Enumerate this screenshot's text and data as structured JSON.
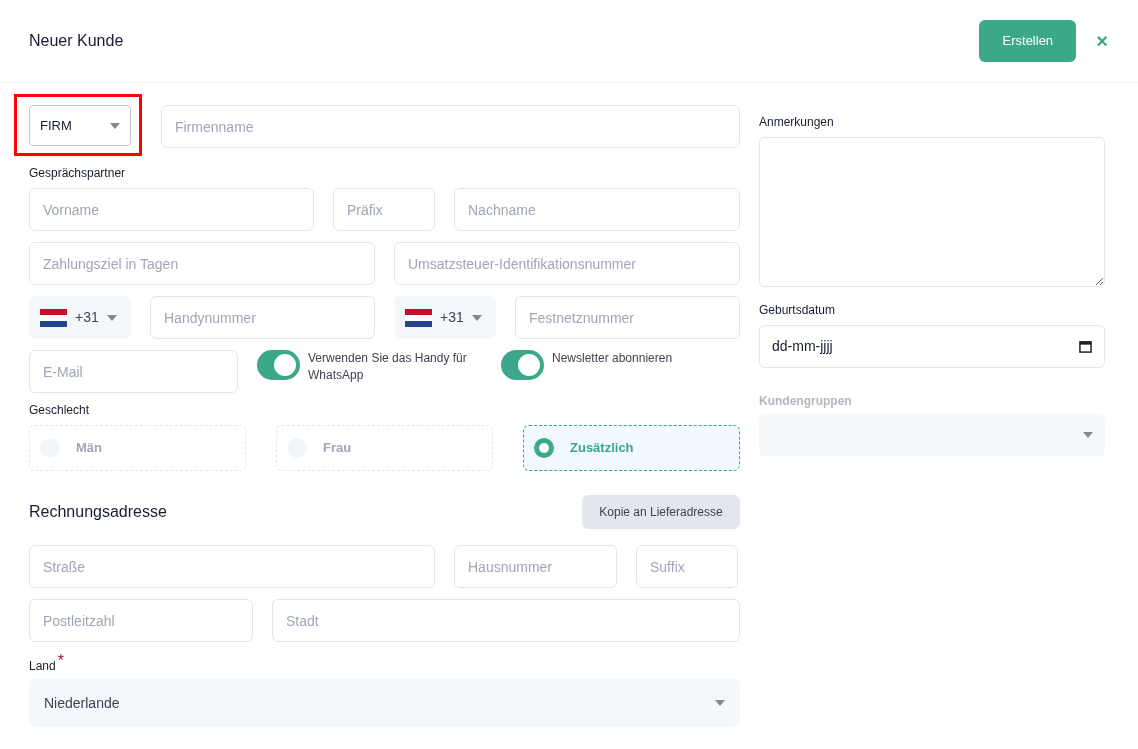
{
  "header": {
    "title": "Neuer Kunde",
    "create_button": "Erstellen",
    "close_button": "×"
  },
  "customer_type": {
    "value": "FIRM",
    "highlighted": true
  },
  "company_name": {
    "placeholder": "Firmenname"
  },
  "contact_label": "Gesprächspartner",
  "contact": [
    {
      "placeholder": "Vorname"
    },
    {
      "placeholder": "Präfix"
    },
    {
      "placeholder": "Nachname"
    }
  ],
  "payment_term": {
    "placeholder": "Zahlungsziel in Tagen"
  },
  "vat_id": {
    "placeholder": "Umsatzsteuer-Identifikationsnummer"
  },
  "phones": [
    {
      "code": "+31",
      "placeholder": "Handynummer"
    },
    {
      "code": "+31",
      "placeholder": "Festnetznummer"
    }
  ],
  "email": {
    "placeholder": "E-Mail"
  },
  "toggles": [
    {
      "label": "Verwenden Sie das Handy für WhatsApp",
      "on": true
    },
    {
      "label": "Newsletter abonnieren",
      "on": true
    }
  ],
  "gender_label": "Geschlecht",
  "genders": [
    {
      "label": "Män",
      "selected": false
    },
    {
      "label": "Frau",
      "selected": false
    },
    {
      "label": "Zusätzlich",
      "selected": true
    }
  ],
  "billing": {
    "title": "Rechnungsadresse",
    "copy_button": "Kopie an Lieferadresse"
  },
  "address_row_1": [
    {
      "placeholder": "Straße"
    },
    {
      "placeholder": "Hausnummer"
    },
    {
      "placeholder": "Suffix"
    }
  ],
  "address_row_2": [
    {
      "placeholder": "Postleitzahl"
    },
    {
      "placeholder": "Stadt"
    }
  ],
  "country": {
    "label": "Land",
    "required_mark": "*",
    "value": "Niederlande"
  },
  "notes": {
    "label": "Anmerkungen"
  },
  "birthdate": {
    "label": "Geburtsdatum",
    "value": "dd-mm-jjjj"
  },
  "customer_groups": {
    "label": "Kundengruppen",
    "disabled": true
  }
}
